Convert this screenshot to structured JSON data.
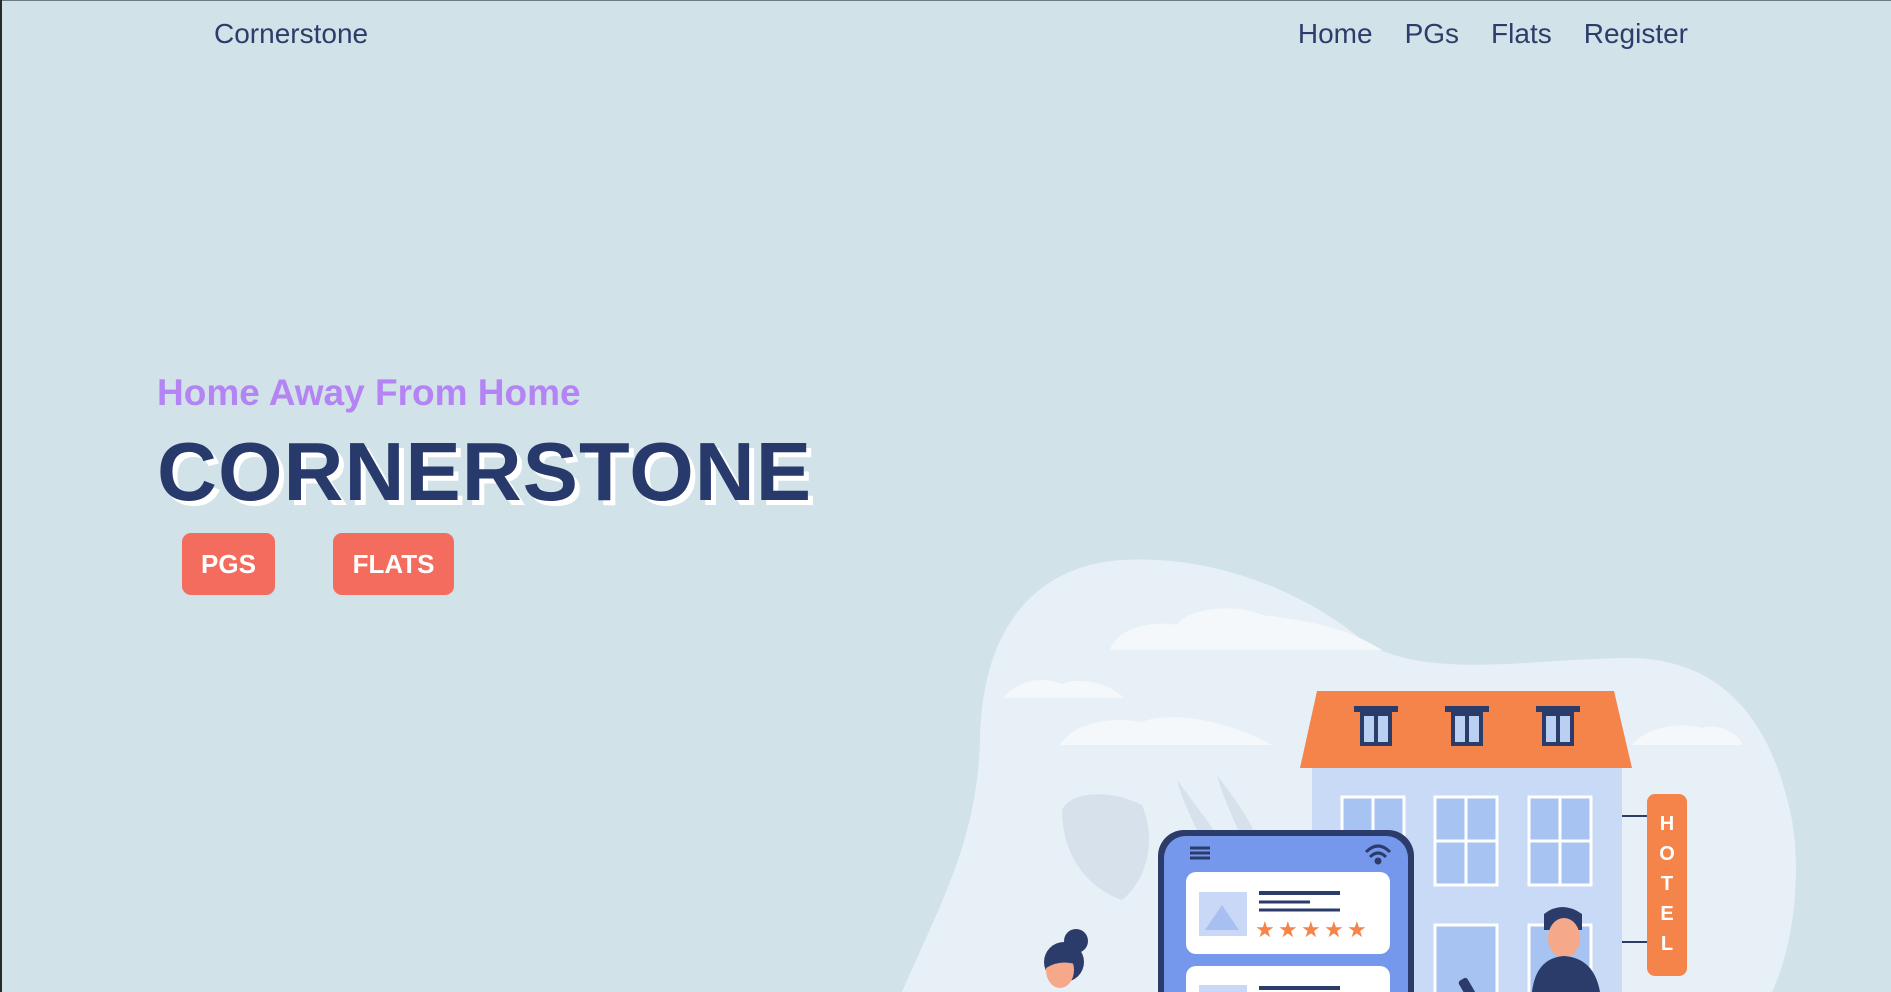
{
  "nav": {
    "brand": "Cornerstone",
    "links": [
      "Home",
      "PGs",
      "Flats",
      "Register"
    ]
  },
  "hero": {
    "tagline": "Home Away From Home",
    "title": "CORNERSTONE",
    "buttons": [
      "PGS",
      "FLATS"
    ]
  },
  "illustration": {
    "hotel_sign": [
      "H",
      "O",
      "T",
      "E",
      "L"
    ]
  },
  "colors": {
    "background": "#d1e2e8",
    "nav_text": "#2d3d6b",
    "tagline": "#b484f5",
    "title": "#28396b",
    "button": "#f36c5e",
    "roof": "#f5844a",
    "phone": "#7598ed"
  }
}
